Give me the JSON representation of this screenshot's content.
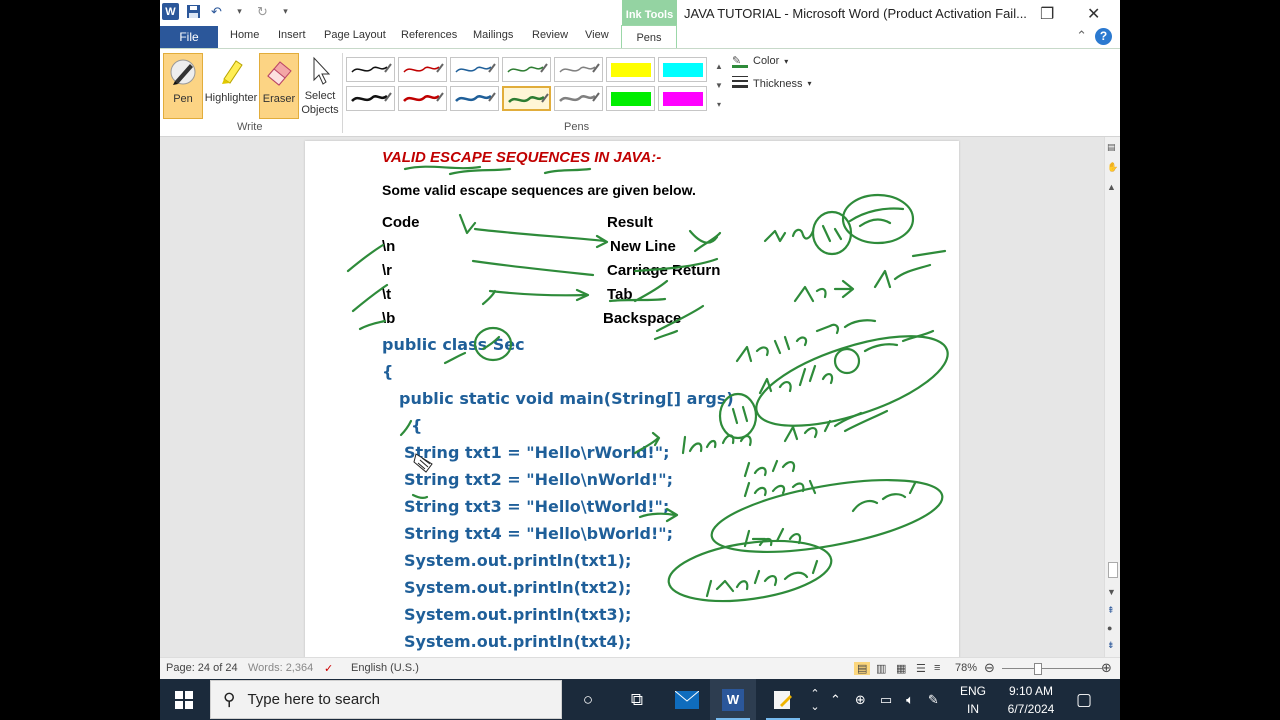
{
  "window": {
    "title": "JAVA TUTORIAL  -  Microsoft Word (Product Activation Fail...",
    "context_tab_group": "Ink Tools"
  },
  "tabs": [
    "File",
    "Home",
    "Insert",
    "Page Layout",
    "References",
    "Mailings",
    "Review",
    "View",
    "Pens"
  ],
  "ribbon": {
    "write_buttons": [
      {
        "label": "Pen",
        "icon": "pen-icon",
        "active": true
      },
      {
        "label": "Highlighter",
        "icon": "highlighter-icon",
        "active": false
      },
      {
        "label": "Eraser",
        "icon": "eraser-icon",
        "active": true
      },
      {
        "label_line1": "Select",
        "label_line2": "Objects",
        "icon": "select-arrow-icon",
        "active": false
      }
    ],
    "write_group": "Write",
    "pens_group": "Pens",
    "pen_colors_row1": [
      "#111111",
      "#c00000",
      "#1f5f99",
      "#2e7d32",
      "#808080",
      "#ffff00",
      "#00ffff"
    ],
    "pen_colors_row2": [
      "#111111",
      "#c00000",
      "#1f5f99",
      "#2e7d32",
      "#808080",
      "#00ee00",
      "#ff00ff"
    ],
    "color_label": "Color",
    "thickness_label": "Thickness"
  },
  "document": {
    "heading": "VALID ESCAPE SEQUENCES IN JAVA:-",
    "intro": "Some valid escape sequences are given below.",
    "table_headers": [
      "Code",
      "Result"
    ],
    "table_rows": [
      {
        "code": "\\n",
        "result": "New Line"
      },
      {
        "code": "\\r",
        "result": "Carriage Return"
      },
      {
        "code": "\\t",
        "result": "Tab"
      },
      {
        "code": "\\b",
        "result": "Backspace"
      }
    ],
    "code_lines": [
      "public class Sec",
      "{",
      "public static void main(String[] args)",
      "{",
      "String txt1 = \"Hello\\rWorld!\";",
      "String txt2 = \"Hello\\nWorld!\";",
      "String txt3 = \"Hello\\tWorld!\";",
      "String txt4 = \"Hello\\bWorld!\";",
      "System.out.println(txt1);",
      "System.out.println(txt2);",
      "System.out.println(txt3);",
      "System.out.println(txt4);"
    ],
    "ink_color": "#2e8b3a"
  },
  "statusbar": {
    "page": "Page: 24 of 24",
    "words": "Words: 2,364",
    "language": "English (U.S.)",
    "zoom": "78%"
  },
  "taskbar": {
    "search_placeholder": "Type here to search",
    "language_line1": "ENG",
    "language_line2": "IN",
    "time": "9:10 AM",
    "date": "6/7/2024"
  }
}
